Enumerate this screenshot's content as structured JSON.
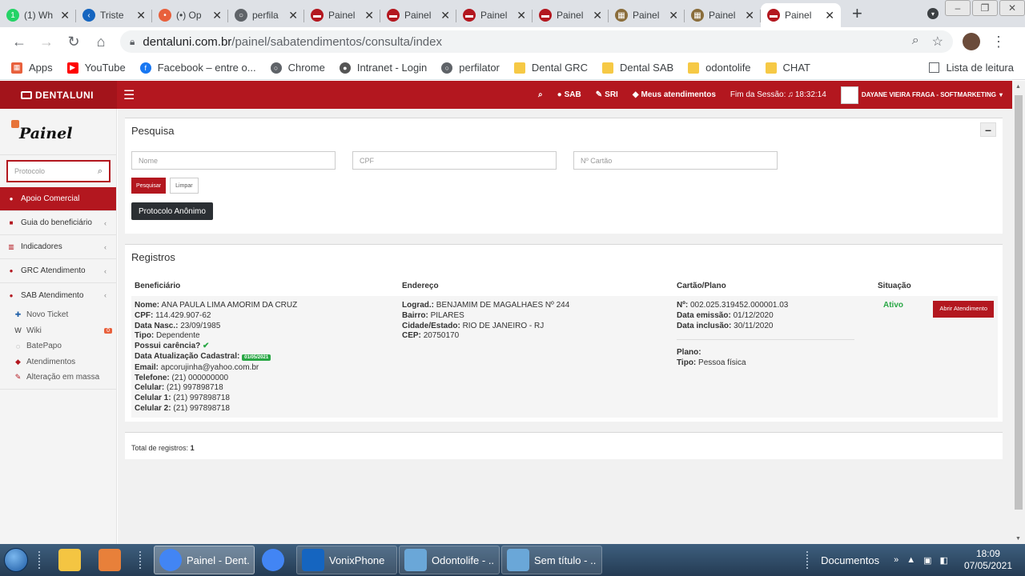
{
  "browser": {
    "tabs": [
      {
        "label": "(1) Wh",
        "color": "#25d366",
        "glyph": "1"
      },
      {
        "label": "Triste",
        "color": "#1565c0",
        "glyph": "<"
      },
      {
        "label": "(•) Op",
        "color": "#e8603c",
        "glyph": "•"
      },
      {
        "label": "perfila",
        "color": "#5f6368",
        "glyph": "○"
      },
      {
        "label": "Painel",
        "color": "#b3171f",
        "glyph": "▬"
      },
      {
        "label": "Painel",
        "color": "#b3171f",
        "glyph": "▬"
      },
      {
        "label": "Painel",
        "color": "#b3171f",
        "glyph": "▬"
      },
      {
        "label": "Painel",
        "color": "#b3171f",
        "glyph": "▬"
      },
      {
        "label": "Painel",
        "color": "#8a6d3b",
        "glyph": "▦"
      },
      {
        "label": "Painel",
        "color": "#8a6d3b",
        "glyph": "▦"
      }
    ],
    "active_tab": {
      "label": "Painel"
    },
    "url_host": "dentaluni.com.br",
    "url_path": "/painel/sabatendimentos/consulta/index",
    "bookmarks": [
      {
        "label": "Apps",
        "color": "#e8603c"
      },
      {
        "label": "YouTube",
        "color": "#ff0000"
      },
      {
        "label": "Facebook – entre o...",
        "color": "#1877f2"
      },
      {
        "label": "Chrome",
        "color": "#5f6368"
      },
      {
        "label": "Intranet - Login",
        "color": "#555555"
      },
      {
        "label": "perfilator",
        "color": "#5f6368"
      },
      {
        "label": "Dental GRC",
        "color": "#f6c945"
      },
      {
        "label": "Dental SAB",
        "color": "#f6c945"
      },
      {
        "label": "odontolife",
        "color": "#f6c945"
      },
      {
        "label": "CHAT",
        "color": "#f6c945"
      }
    ],
    "reading_list": "Lista de leitura"
  },
  "app": {
    "brand": "DENTALUNI",
    "nav": {
      "sab": "SAB",
      "sri": "SRI",
      "meus": "Meus atendimentos",
      "session": "Fim da Sessão:",
      "session_time": "18:32:14",
      "user": "DAYANE VIEIRA FRAGA - SOFTMARKETING"
    },
    "logo": "Painel",
    "protocol_placeholder": "Protocolo",
    "menu": {
      "apoio": "Apoio Comercial",
      "guia": "Guia do beneficiário",
      "indicadores": "Indicadores",
      "grc": "GRC Atendimento",
      "sab": "SAB Atendimento"
    },
    "submenu": {
      "novo_ticket": "Novo Ticket",
      "wiki": "Wiki",
      "wiki_count": "0",
      "batepapo": "BatePapo",
      "atendimentos": "Atendimentos",
      "alteracao": "Alteração em massa"
    }
  },
  "search": {
    "title": "Pesquisa",
    "nome_placeholder": "Nome",
    "cpf_placeholder": "CPF",
    "cartao_placeholder": "Nº Cartão",
    "pesquisar": "Pesquisar",
    "limpar": "Limpar",
    "anonimo": "Protocolo Anônimo"
  },
  "records": {
    "title": "Registros",
    "headers": {
      "beneficiario": "Beneficiário",
      "endereco": "Endereço",
      "cartao": "Cartão/Plano",
      "situacao": "Situação"
    },
    "row": {
      "nome_label": "Nome:",
      "nome": "ANA PAULA LIMA AMORIM DA CRUZ",
      "cpf_label": "CPF:",
      "cpf": "114.429.907-62",
      "nasc_label": "Data Nasc.:",
      "nasc": "23/09/1985",
      "tipo_label": "Tipo:",
      "tipo": "Dependente",
      "carencia_label": "Possui carência?",
      "atualizacao_label": "Data Atualização Cadastral:",
      "atualizacao": "01/05/2021",
      "email_label": "Email:",
      "email": "apcorujinha@yahoo.com.br",
      "telefone_label": "Telefone:",
      "telefone": "(21) 000000000",
      "celular_label": "Celular:",
      "celular": "(21) 997898718",
      "celular1_label": "Celular 1:",
      "celular1": "(21) 997898718",
      "celular2_label": "Celular 2:",
      "celular2": "(21) 997898718",
      "lograd_label": "Lograd.:",
      "lograd": "BENJAMIM DE MAGALHAES Nº 244",
      "bairro_label": "Bairro:",
      "bairro": "PILARES",
      "cidade_label": "Cidade/Estado:",
      "cidade": "RIO DE JANEIRO - RJ",
      "cep_label": "CEP:",
      "cep": "20750170",
      "numero_label": "Nº:",
      "numero": "002.025.319452.000001.03",
      "emissao_label": "Data emissão:",
      "emissao": "01/12/2020",
      "inclusao_label": "Data inclusão:",
      "inclusao": "30/11/2020",
      "plano_label": "Plano:",
      "tipo_plano_label": "Tipo:",
      "tipo_plano": "Pessoa física",
      "situacao": "Ativo",
      "abrir": "Abrir Atendimento"
    },
    "total_label": "Total de registros:",
    "total": "1"
  },
  "taskbar": {
    "items": [
      {
        "label": "Painel - Dent...",
        "color": "#4285f4"
      },
      {
        "label": "",
        "color": "#4285f4"
      },
      {
        "label": "VonixPhone",
        "color": "#1565c0"
      },
      {
        "label": "Odontolife - ...",
        "color": "#6aa7d8"
      },
      {
        "label": "Sem título - ...",
        "color": "#6aa7d8"
      }
    ],
    "documents": "Documentos",
    "time": "18:09",
    "date": "07/05/2021"
  }
}
